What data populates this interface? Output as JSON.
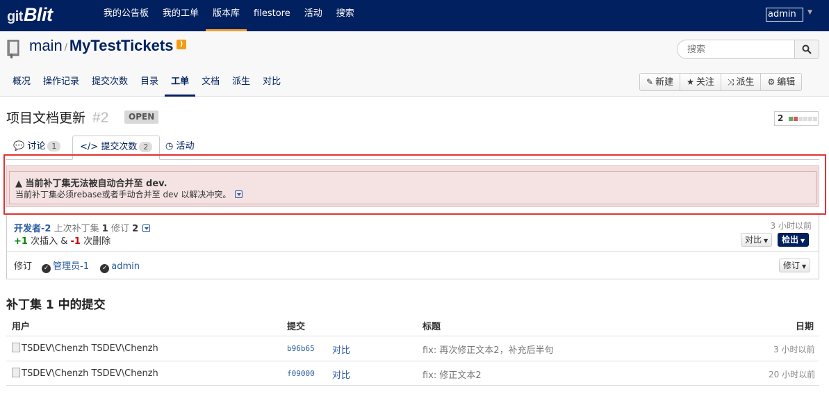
{
  "app": {
    "logo": "Blit",
    "logo_prefix": "git",
    "nav": [
      "我的公告板",
      "我的工单",
      "版本库",
      "filestore",
      "活动",
      "搜索"
    ],
    "nav_active": "版本库",
    "user": "admin"
  },
  "repo": {
    "group": "main",
    "name": "MyTestTickets",
    "search_placeholder": "搜索",
    "subnav": [
      "概况",
      "操作记录",
      "提交次数",
      "目录",
      "工单",
      "文档",
      "派生",
      "对比"
    ],
    "subnav_active": "工单",
    "actions": [
      "新建",
      "关注",
      "派生",
      "编辑"
    ]
  },
  "ticket": {
    "title": "项目文档更新",
    "number": "#2",
    "status": "OPEN",
    "votes": "2",
    "tabs": [
      {
        "label": "讨论",
        "count": "1"
      },
      {
        "label": "提交次数",
        "count": "2"
      },
      {
        "label": "活动",
        "count": ""
      }
    ]
  },
  "warning": {
    "heading": "当前补丁集无法被自动合并至 dev.",
    "body": "当前补丁集必须rebase或者手动合并至 dev 以解决冲突。"
  },
  "patchset": {
    "author": "开发者-2",
    "desc_a": "上次补丁集",
    "ps_num": "1",
    "desc_b": "修订",
    "rev_num": "2",
    "insert_count": "+1",
    "insert_label": "次插入 &",
    "delete_count": "-1",
    "delete_label": "次删除",
    "time": "3 小时以前",
    "compare_btn": "对比",
    "checkout_btn": "检出",
    "review_label": "修订",
    "reviewers": [
      "管理员-1",
      "admin"
    ],
    "review_btn": "修订"
  },
  "commits": {
    "title": "补丁集 1 中的提交",
    "headers": {
      "user": "用户",
      "commit": "提交",
      "subject": "标题",
      "date": "日期"
    },
    "rows": [
      {
        "avatar_alt": "TSDEV\\Chenzh",
        "user": "TSDEV\\Chenzh",
        "hash": "b96b65",
        "compare": "对比",
        "subject": "fix: 再次修正文本2，补充后半句",
        "date": "3 小时以前"
      },
      {
        "avatar_alt": "TSDEV\\Chenzh",
        "user": "TSDEV\\Chenzh",
        "hash": "f09000",
        "compare": "对比",
        "subject": "fix: 修正文本2",
        "date": "20 小时以前"
      }
    ]
  },
  "colors": {
    "navbar": "#002060",
    "accent": "#f0a030",
    "link": "#2a5aa0",
    "alert_bg": "#f2dede",
    "highlight_frame": "#dd3333"
  }
}
